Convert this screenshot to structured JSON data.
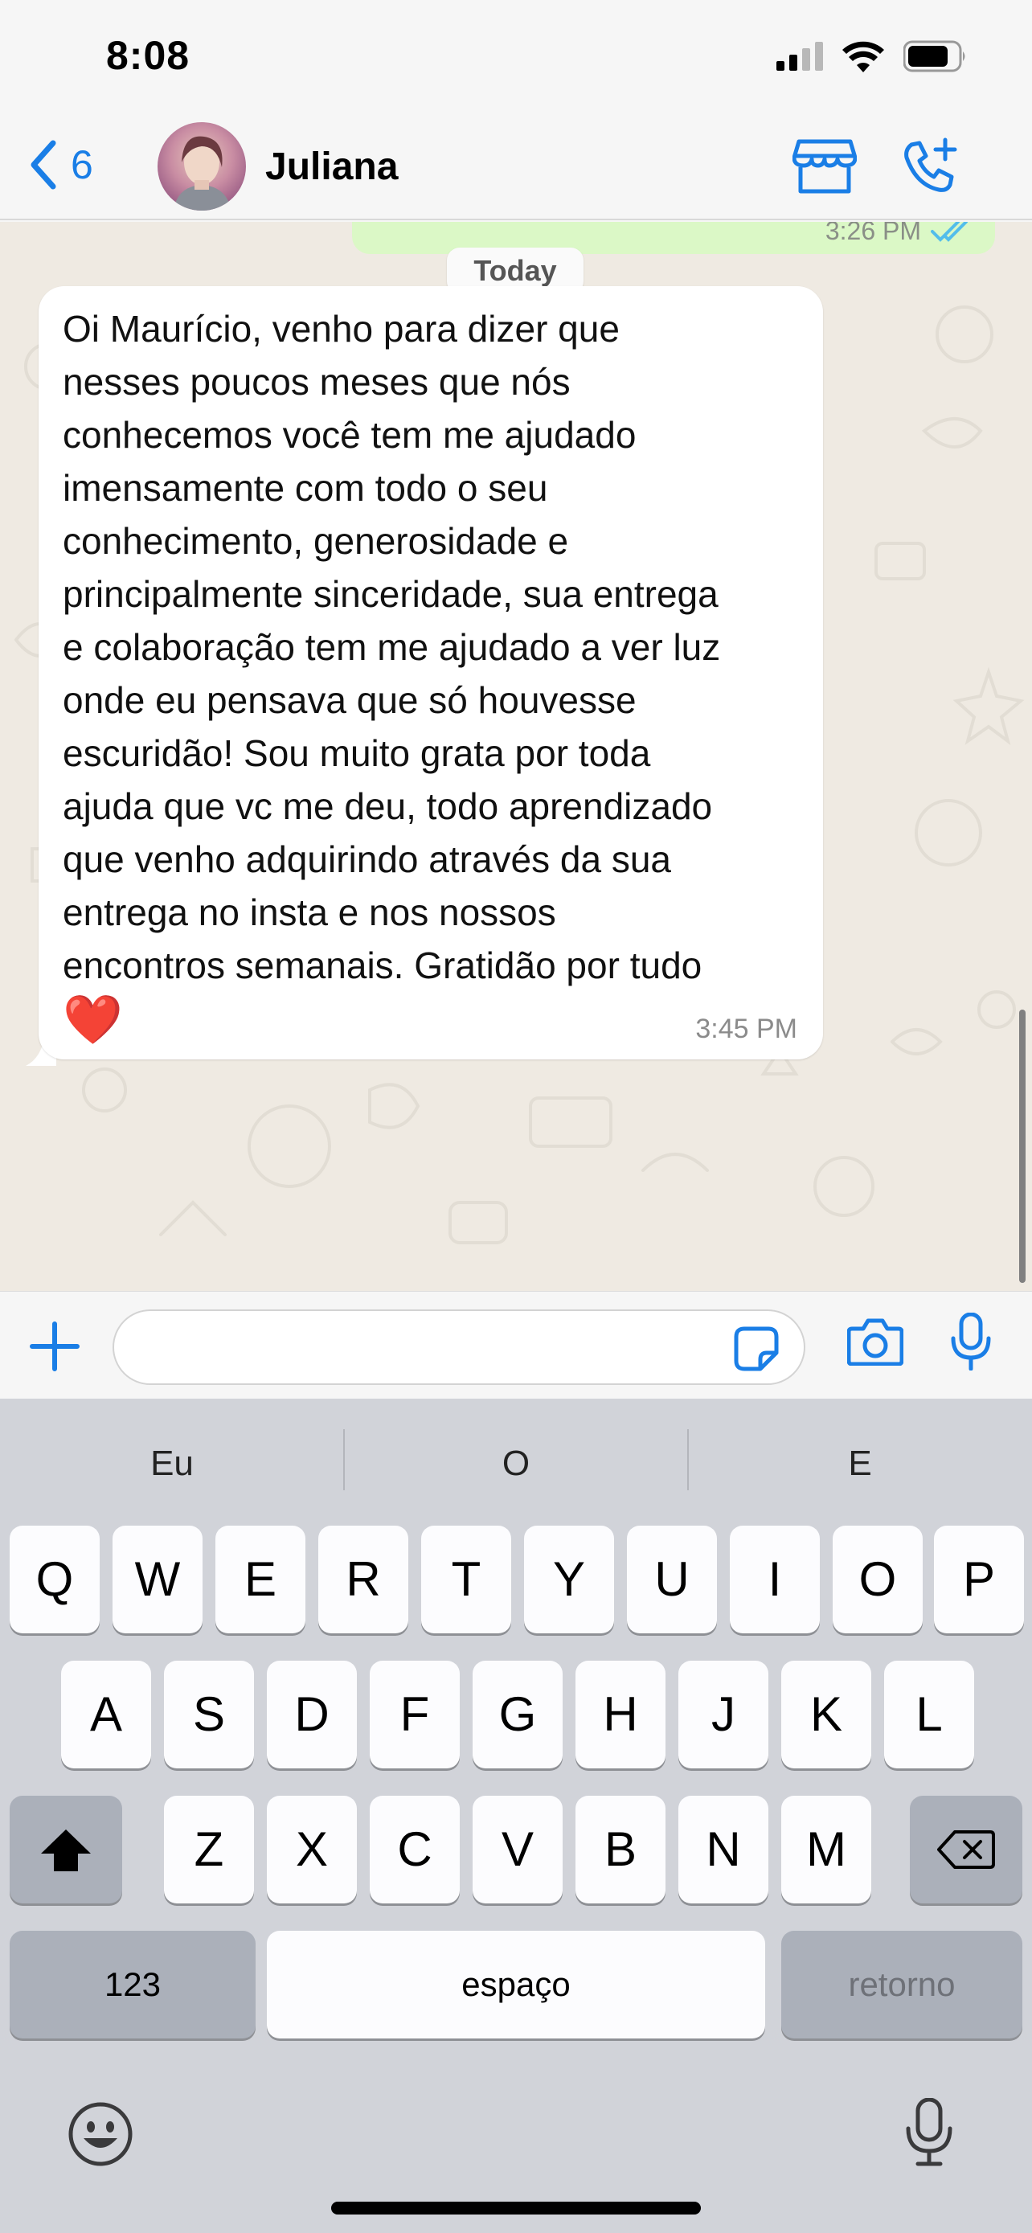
{
  "status_bar": {
    "time": "8:08",
    "battery_fraction": 0.82
  },
  "header": {
    "back_count": "6",
    "contact_name": "Juliana"
  },
  "chat": {
    "previous_out_time": "3:26 PM",
    "day_separator": "Today",
    "incoming_message": {
      "text": "Oi Maurício, venho para dizer que\nnesses poucos meses que nós\nconhecemos você tem me ajudado\nimensamente com todo o seu\nconhecimento, generosidade e\nprincipalmente sinceridade, sua entrega\ne colaboração tem me ajudado a ver luz\nonde eu pensava que só houvesse\nescuridão! Sou muito grata por toda\najuda que vc me deu, todo aprendizado\nque venho adquirindo através da sua\nentrega no insta e nos nossos\nencontros semanais. Gratidão por tudo",
      "emoji": "❤️",
      "time": "3:45 PM"
    }
  },
  "input": {
    "placeholder": ""
  },
  "keyboard": {
    "predictions": [
      "Eu",
      "O",
      "E"
    ],
    "row1": [
      "Q",
      "W",
      "E",
      "R",
      "T",
      "Y",
      "U",
      "I",
      "O",
      "P"
    ],
    "row2": [
      "A",
      "S",
      "D",
      "F",
      "G",
      "H",
      "J",
      "K",
      "L"
    ],
    "row3": [
      "Z",
      "X",
      "C",
      "V",
      "B",
      "N",
      "M"
    ],
    "numbers_key": "123",
    "space_key": "espaço",
    "return_key": "retorno"
  },
  "colors": {
    "accent": "#1a7ee6",
    "outgoing_bubble": "#dbf8c6",
    "chat_bg": "#efeae2",
    "read_ticks": "#53bdeb"
  }
}
